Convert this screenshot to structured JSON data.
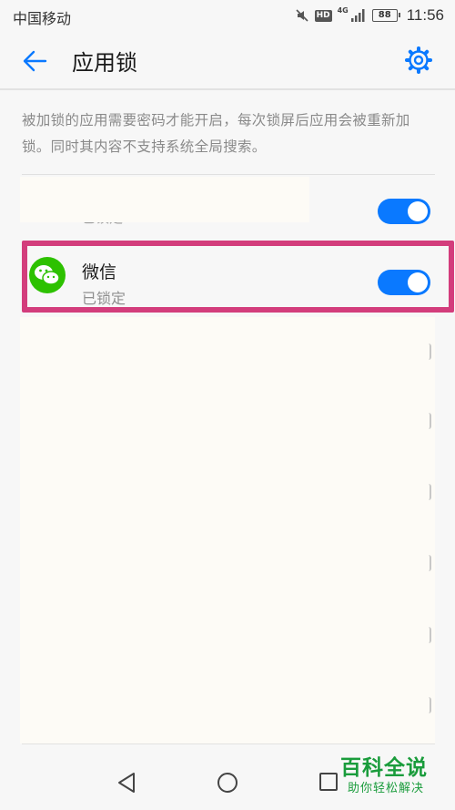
{
  "status_bar": {
    "carrier": "中国移动",
    "hd": "HD",
    "network": "4G",
    "battery": "88",
    "time": "11:56"
  },
  "header": {
    "title": "应用锁",
    "back_icon": "arrow-left-icon",
    "settings_icon": "gear-icon"
  },
  "description": "被加锁的应用需要密码才能开启，每次锁屏后应用会被重新加锁。同时其内容不支持系统全局搜索。",
  "apps": [
    {
      "name": "",
      "status": "已锁定",
      "locked": true
    },
    {
      "name": "微信",
      "status": "已锁定",
      "locked": true,
      "icon": "wechat-icon"
    }
  ],
  "colors": {
    "accent": "#0a79ff",
    "highlight": "#d33d7c",
    "watermark": "#1a9c3c"
  },
  "watermark": {
    "main": "百科全说",
    "sub": "助你轻松解决"
  }
}
